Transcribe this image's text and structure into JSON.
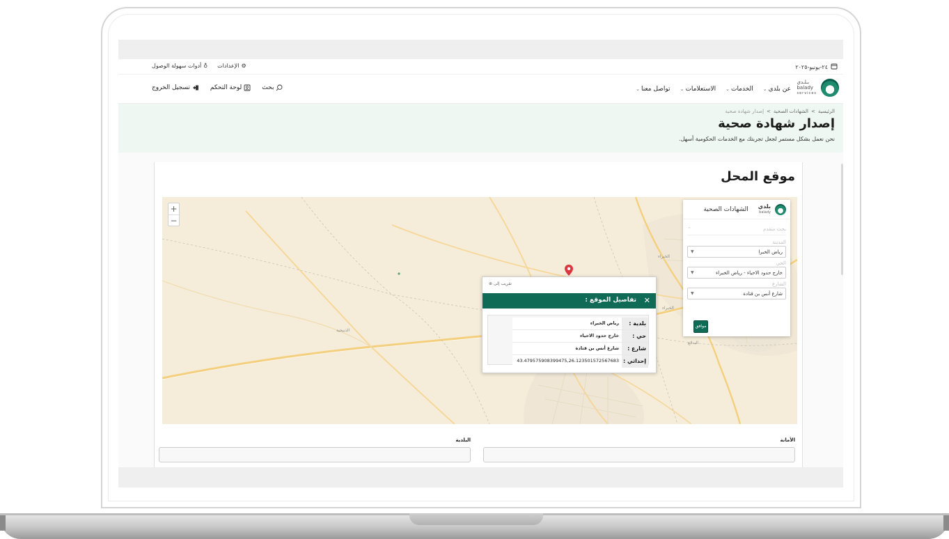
{
  "utility_bar": {
    "date": "٢٤-يونيو-٢٠٢٥",
    "settings_label": "الإعدادات",
    "accessibility_label": "أدوات سهولة الوصول"
  },
  "brand": {
    "logo_line1": "بـلـدي",
    "logo_line2": "balady",
    "logo_line3": "services"
  },
  "nav": {
    "items": [
      {
        "label": "عن بلدي"
      },
      {
        "label": "الخدمات"
      },
      {
        "label": "الاستعلامات"
      },
      {
        "label": "تواصل معنا"
      }
    ],
    "search_label": "بحث",
    "dashboard_label": "لوحة التحكم",
    "logout_label": "تسجيل الخروج"
  },
  "breadcrumb": {
    "home": "الرئيسية",
    "sep": ">",
    "section": "الشهادات الصحية",
    "current": "إصدار شهادة صحية"
  },
  "hero": {
    "title": "إصدار شهادة صحية",
    "subtitle": "نحن نعمل بشكل مستمر لجعل تجربتك مع الخدمات الحكومية أسهل."
  },
  "section": {
    "title": "موقع المحل"
  },
  "map": {
    "zoom_in": "+",
    "zoom_out": "−",
    "place_labels": {
      "khabra_top": "الخبراء",
      "khabra_mid": "الخبراء",
      "dhabitia": "الذبيحية",
      "badaie": "البدائع"
    }
  },
  "filter_panel": {
    "brand": "بلدي",
    "brand_sub": "balady",
    "title": "الشهادات الصحية",
    "advanced_search": "بحث متقدم",
    "city_label": "المدينة",
    "city_value": "رياض الخبرا",
    "district_label": "الحي",
    "district_value": "خارج حدود الاحياء - رياض الخبراء",
    "street_label": "الشارع",
    "street_value": "شارع أنس بن قتادة",
    "ok_label": "موافق"
  },
  "popup": {
    "zoom_label": "تقريب إلى",
    "title": "تفاصيل الموقع :",
    "rows": [
      {
        "label": "بلدية :",
        "value": "رياض الخبراء"
      },
      {
        "label": "حي :",
        "value": "خارج حدود الاحياء"
      },
      {
        "label": "شارع :",
        "value": "شارع أنس بن قتادة"
      },
      {
        "label": "إحداثي :",
        "value": "43.479575908399475,26.123501572567683"
      }
    ]
  },
  "form": {
    "amana_label": "الأمانة",
    "baladiya_label": "البلدية"
  },
  "colors": {
    "primary": "#0f6a56",
    "hero_bg": "#eef7f1",
    "map_bg": "#f5edd9",
    "pin": "#d9363e"
  }
}
